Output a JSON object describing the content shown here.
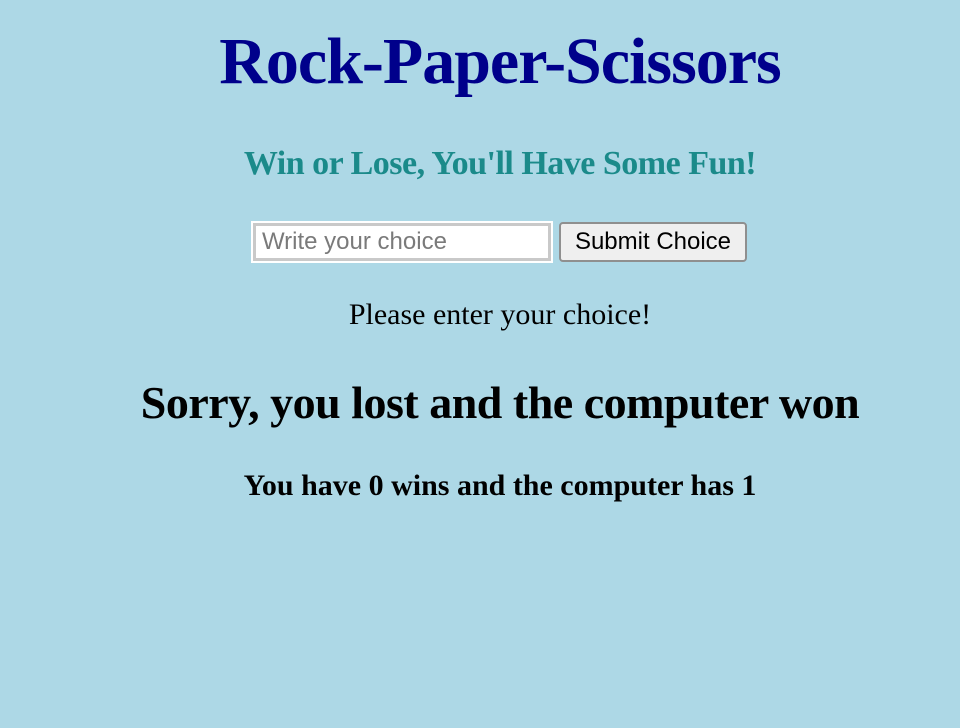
{
  "page": {
    "title": "Rock-Paper-Scissors",
    "subtitle": "Win or Lose, You'll Have Some Fun!",
    "form": {
      "input_value": "",
      "input_placeholder": "Write your choice",
      "submit_label": "Submit Choice"
    },
    "message": "Please enter your choice!",
    "result": "Sorry, you lost and the computer won",
    "score": "You have 0 wins and the computer has 1"
  },
  "colors": {
    "background": "#add8e6",
    "title": "#00008b",
    "subtitle": "#1b8a8a"
  }
}
